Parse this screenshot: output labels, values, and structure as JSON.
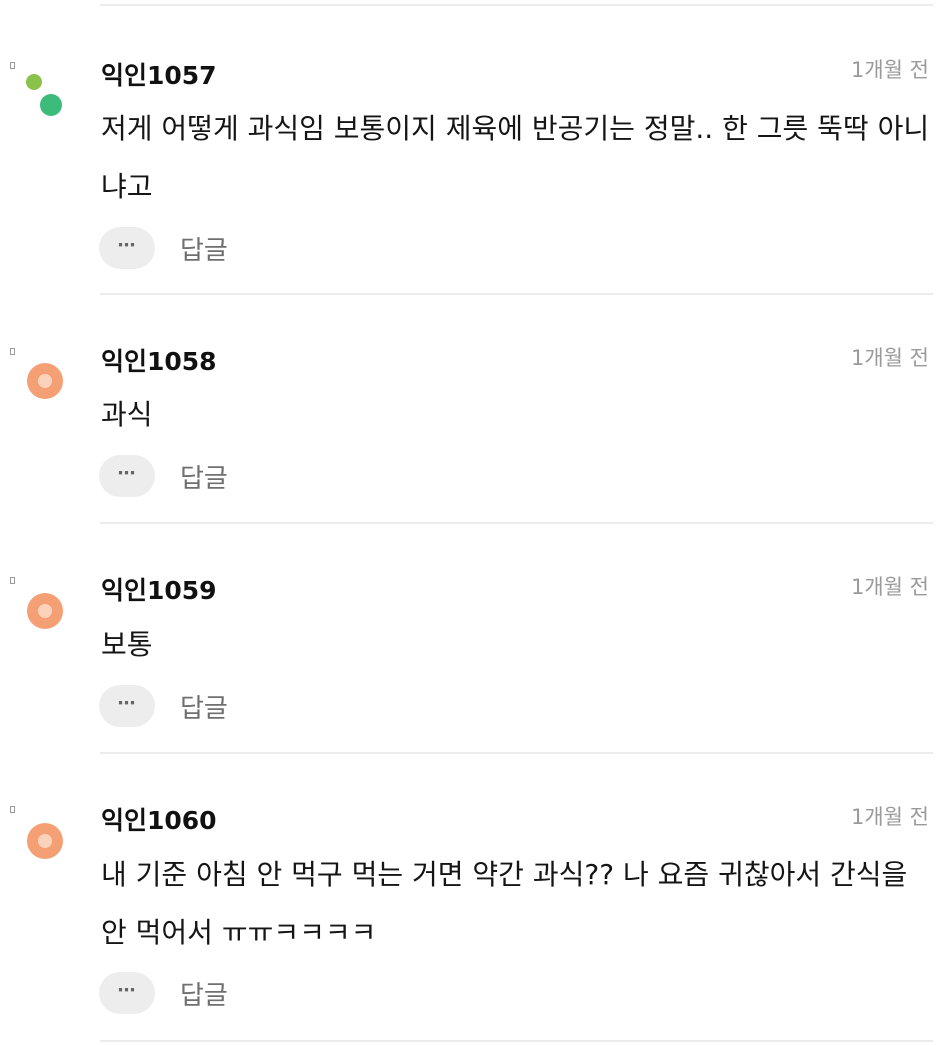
{
  "comments": [
    {
      "author": "익인1057",
      "time": "1개월 전",
      "text": "저게 어떻게 과식임 보통이지 제육에 반공기는 정말.. 한 그릇 뚝딱 아니냐고",
      "avatar": "green-dots",
      "more_icon": "⋯",
      "reply_label": "답글"
    },
    {
      "author": "익인1058",
      "time": "1개월 전",
      "text": "과식",
      "avatar": "orange-ring",
      "more_icon": "⋯",
      "reply_label": "답글"
    },
    {
      "author": "익인1059",
      "time": "1개월 전",
      "text": "보통",
      "avatar": "orange-ring",
      "more_icon": "⋯",
      "reply_label": "답글"
    },
    {
      "author": "익인1060",
      "time": "1개월 전",
      "text": "내 기준 아침 안 먹구 먹는 거면 약간 과식?? 나 요즘 귀찮아서 간식을 안 먹어서 ㅠㅠㅋㅋㅋㅋ",
      "avatar": "orange-ring",
      "more_icon": "⋯",
      "reply_label": "답글"
    }
  ]
}
